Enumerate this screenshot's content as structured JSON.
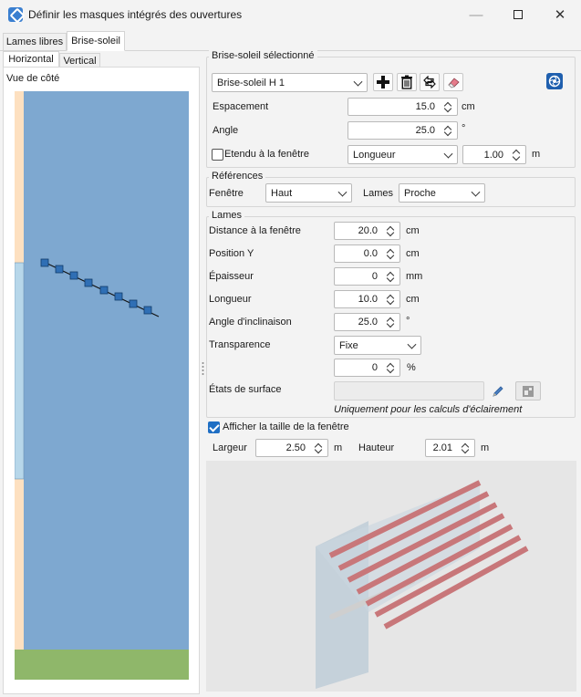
{
  "window": {
    "title": "Définir les masques intégrés des ouvertures"
  },
  "tabs": {
    "lames_libres": "Lames libres",
    "brise_soleil": "Brise-soleil"
  },
  "subtabs": {
    "horizontal": "Horizontal",
    "vertical": "Vertical"
  },
  "left": {
    "view_label": "Vue de côté"
  },
  "selected": {
    "group_label": "Brise-soleil sélectionné",
    "combo_value": "Brise-soleil H 1",
    "espacement": {
      "label": "Espacement",
      "value": "15.0",
      "unit": "cm"
    },
    "angle": {
      "label": "Angle",
      "value": "25.0",
      "unit": "°"
    },
    "etendu": {
      "label": "Etendu à la fenêtre",
      "combo": "Longueur",
      "value": "1.00",
      "unit": "m"
    }
  },
  "references": {
    "group_label": "Références",
    "fenetre_label": "Fenêtre",
    "fenetre_value": "Haut",
    "lames_label": "Lames",
    "lames_value": "Proche"
  },
  "lames": {
    "group_label": "Lames",
    "fields": [
      {
        "label": "Distance à la fenêtre",
        "value": "20.0",
        "unit": "cm"
      },
      {
        "label": "Position Y",
        "value": "0.0",
        "unit": "cm"
      },
      {
        "label": "Épaisseur",
        "value": "0",
        "unit": "mm"
      },
      {
        "label": "Longueur",
        "value": "10.0",
        "unit": "cm"
      },
      {
        "label": "Angle d'inclinaison",
        "value": "25.0",
        "unit": "°"
      }
    ],
    "transparence": {
      "label": "Transparence",
      "value": "Fixe",
      "percent_value": "0",
      "percent_unit": "%"
    },
    "etats": {
      "label": "États de surface",
      "value": "",
      "note": "Uniquement pour les calculs d'éclairement"
    }
  },
  "window_size": {
    "checkbox_label": "Afficher la taille de la fenêtre",
    "largeur_label": "Largeur",
    "largeur_value": "2.50",
    "largeur_unit": "m",
    "hauteur_label": "Hauteur",
    "hauteur_value": "2.01",
    "hauteur_unit": "m"
  },
  "colors": {
    "sky": "#7ea8d0",
    "ground": "#8fb76a",
    "wall": "#fde0c0",
    "glass": "#b7d7ea",
    "slat": "#c8777a",
    "accent": "#1f6fc4"
  }
}
